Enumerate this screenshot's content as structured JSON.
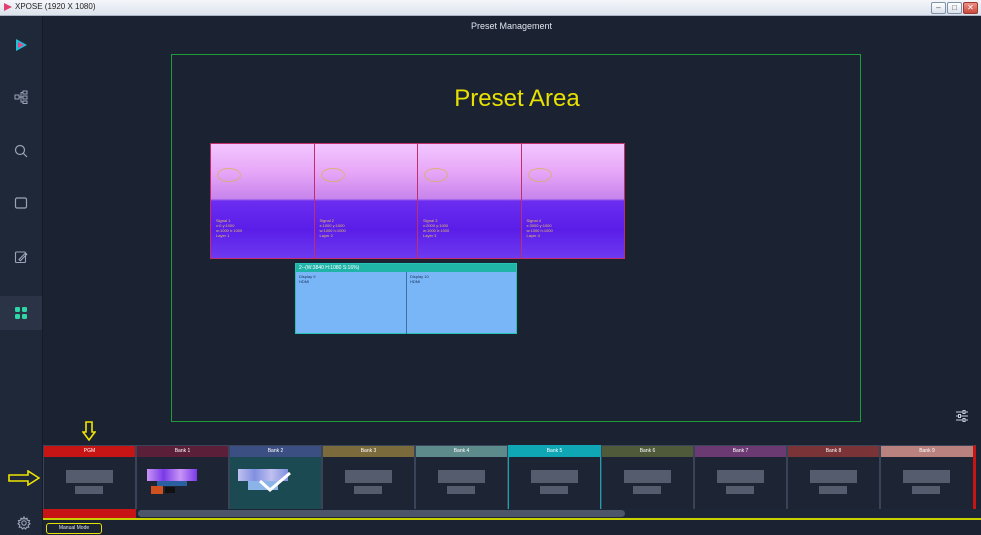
{
  "window": {
    "title": "XPOSE (1920 X 1080)",
    "controls": [
      "–",
      "□",
      "✕"
    ]
  },
  "header": {
    "title": "Preset Management"
  },
  "sidebar": {
    "items": [
      {
        "icon": "play-logo-icon"
      },
      {
        "icon": "topology-icon"
      },
      {
        "icon": "search-icon"
      },
      {
        "icon": "screen-icon"
      },
      {
        "icon": "edit-icon"
      },
      {
        "icon": "grid-icon",
        "active": true
      }
    ],
    "settings_icon": "gear-icon"
  },
  "preset_area": {
    "label": "Preset Area",
    "layers": [
      {
        "lines": [
          "Signal 1",
          "x:0 y:1000",
          "w:1000 h:1000",
          "Layer 1"
        ]
      },
      {
        "lines": [
          "Signal 2",
          "x:1000 y:1000",
          "w:1000 h:1000",
          "Layer 2"
        ]
      },
      {
        "lines": [
          "Signal 3",
          "x:2000 y:1000",
          "w:1000 h:1000",
          "Layer 3"
        ]
      },
      {
        "lines": [
          "Signal 4",
          "x:3000 y:1000",
          "w:1000 h:1000",
          "Layer 4"
        ]
      }
    ],
    "screen": {
      "header": "2--(W:3840 H:1080 S:16%)",
      "displays": [
        {
          "name": "Display 9",
          "port": "HDMI"
        },
        {
          "name": "Display 10",
          "port": "HDMI"
        }
      ]
    }
  },
  "banks": [
    {
      "label": "PGM",
      "color": "#c71414",
      "body": "#1d2433"
    },
    {
      "label": "Bank 1",
      "color": "#5c1f3a",
      "body": "#1d2433",
      "thumb": "preset-thumbnail"
    },
    {
      "label": "Bank 2",
      "color": "#3c4f82",
      "body": "#1c4a52",
      "thumb": "preset-thumbnail-selected"
    },
    {
      "label": "Bank 3",
      "color": "#7b6a3c",
      "body": "#1d2433"
    },
    {
      "label": "Bank 4",
      "color": "#5d8a8a",
      "body": "#1d2433"
    },
    {
      "label": "Bank 5",
      "color": "#0fa7b5",
      "body": "#1d2433"
    },
    {
      "label": "Bank 6",
      "color": "#4e5a3a",
      "body": "#1d2433"
    },
    {
      "label": "Bank 7",
      "color": "#6b3a72",
      "body": "#1d2433"
    },
    {
      "label": "Bank 8",
      "color": "#7a3438",
      "body": "#1d2433"
    },
    {
      "label": "Bank 9",
      "color": "#b9827f",
      "body": "#1d2433"
    }
  ],
  "footer": {
    "mode": "Manual Mode"
  },
  "colors": {
    "accent": "#e5e100",
    "frame": "#1f9c3a",
    "pgm": "#c71414"
  }
}
